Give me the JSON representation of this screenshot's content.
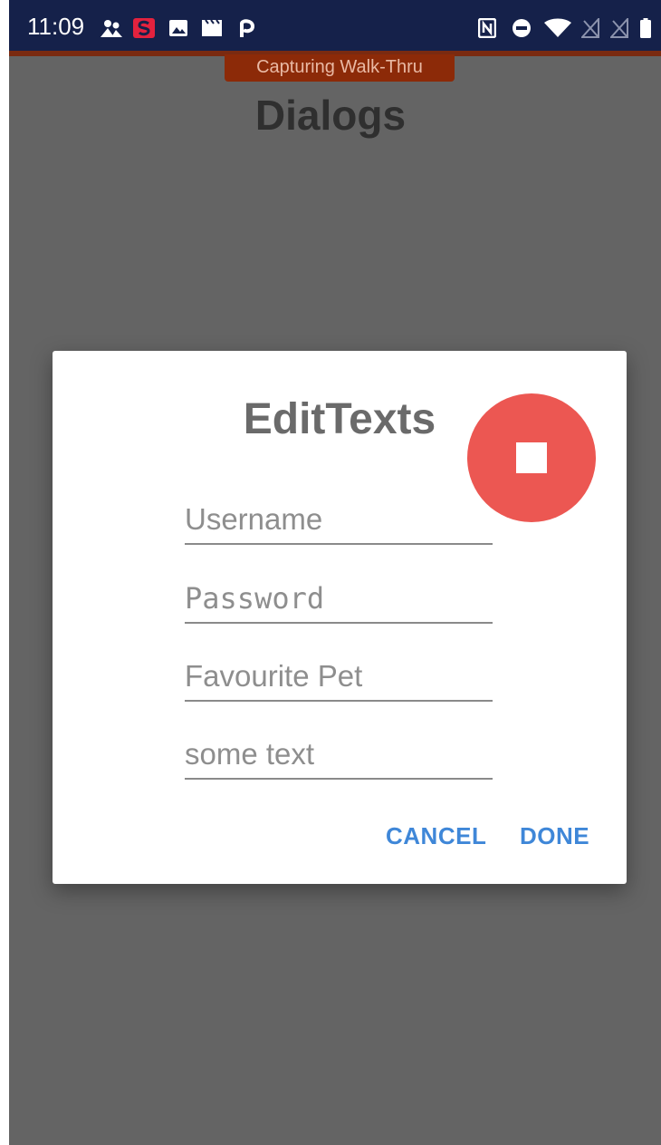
{
  "status_bar": {
    "time": "11:09",
    "left_icons": [
      "people-icon",
      "s-app-icon",
      "image-icon",
      "clapper-icon",
      "p-app-icon"
    ],
    "right_icons": [
      "nfc-icon",
      "do-not-disturb-icon",
      "wifi-icon",
      "no-signal-icon",
      "no-signal-icon",
      "battery-icon"
    ]
  },
  "capture_banner": "Capturing Walk-Thru",
  "page_title": "Dialogs",
  "dialog": {
    "title": "EditTexts",
    "fields": [
      {
        "placeholder": "Username",
        "value": ""
      },
      {
        "placeholder": "Password",
        "value": ""
      },
      {
        "placeholder": "Favourite Pet",
        "value": ""
      },
      {
        "placeholder": "some text",
        "value": ""
      }
    ],
    "cancel_label": "CANCEL",
    "done_label": "DONE"
  },
  "stop_button": {
    "icon": "stop-icon"
  },
  "colors": {
    "status_bar": "#15214a",
    "banner": "#8c2a08",
    "scrim": "#646464",
    "accent": "#3f87d8",
    "record_button": "#ec5752"
  }
}
